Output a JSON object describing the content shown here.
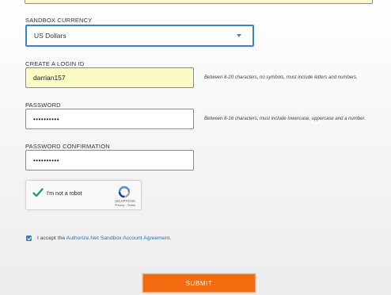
{
  "currency": {
    "label": "SANDBOX CURRENCY",
    "value": "US Dollars"
  },
  "login_id": {
    "label": "CREATE A LOGIN ID",
    "value": "darrian157",
    "hint": "Between 8-20 characters, no symbols, must include letters and numbers."
  },
  "password": {
    "label": "PASSWORD",
    "value": "••••••••••",
    "hint": "Between 8-16 characters, must include lowercase, uppercase and a number."
  },
  "password_confirmation": {
    "label": "PASSWORD CONFIRMATION",
    "value": "••••••••••"
  },
  "recaptcha": {
    "label": "I'm not a robot",
    "brand": "reCAPTCHA",
    "links": "Privacy - Terms"
  },
  "agreement": {
    "prefix": "I accept the ",
    "link": "Authorize.Net Sandbox Account Agreement",
    "suffix": ".",
    "checked": true
  },
  "submit_label": "SUBMIT",
  "colors": {
    "accent": "#f26b0f",
    "focus_border": "#3b84c4",
    "autofill_bg": "#fbfbc4",
    "link": "#2a6fb3"
  }
}
